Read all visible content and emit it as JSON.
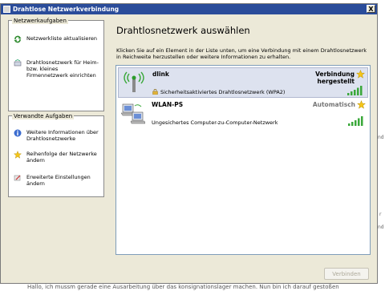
{
  "window": {
    "title": "Drahtlose Netzwerkverbindung",
    "close_glyph": "X"
  },
  "sidebar": {
    "network_tasks": {
      "header": "Netzwerkaufgaben",
      "items": [
        {
          "label": "Netzwerkliste aktualisieren",
          "icon": "refresh-icon"
        },
        {
          "label": "Drahtlosnetzwerk für Heim- bzw. kleines Firmennetzwerk einrichten",
          "icon": "wizard-icon"
        }
      ]
    },
    "related_tasks": {
      "header": "Verwandte Aufgaben",
      "items": [
        {
          "label": "Weitere Informationen über Drahtlosnetzwerke",
          "icon": "info-icon"
        },
        {
          "label": "Reihenfolge der Netzwerke ändern",
          "icon": "star-icon"
        },
        {
          "label": "Erweiterte Einstellungen ändern",
          "icon": "settings-icon"
        }
      ]
    }
  },
  "main": {
    "heading": "Drahtlosnetzwerk auswählen",
    "instructions": "Klicken Sie auf ein Element in der Liste unten, um eine Verbindung mit einem Drahtlosnetzwerk in Reichweite herzustellen oder weitere Informationen zu erhalten.",
    "networks": [
      {
        "name": "dlink",
        "status_line1": "Verbindung",
        "status_line2": "hergestellt",
        "security": "Sicherheitsaktiviertes Drahtlosnetzwerk (WPA2)",
        "signal_level": 5,
        "selected": true,
        "secured": true
      },
      {
        "name": "WLAN-PS",
        "status_line1": "Automatisch",
        "status_line2": "",
        "security": "Ungesichertes Computer-zu-Computer-Netzwerk",
        "signal_level": 5,
        "selected": false,
        "secured": false
      }
    ],
    "connect_button": "Verbinden"
  },
  "background": {
    "bottom_text": "Hallo, ich mussm gerade eine Ausarbeitung über das konsignationslager machen. Nun bin ich darauf gestoßen",
    "right_fragments": [
      "nd",
      "r",
      "nd"
    ]
  },
  "colors": {
    "titlebar": "#2a4c9a",
    "dialog_bg": "#ece9d8",
    "selected_row": "#dde2ef",
    "signal_green": "#3aa83a",
    "star_yellow": "#f5c518"
  }
}
